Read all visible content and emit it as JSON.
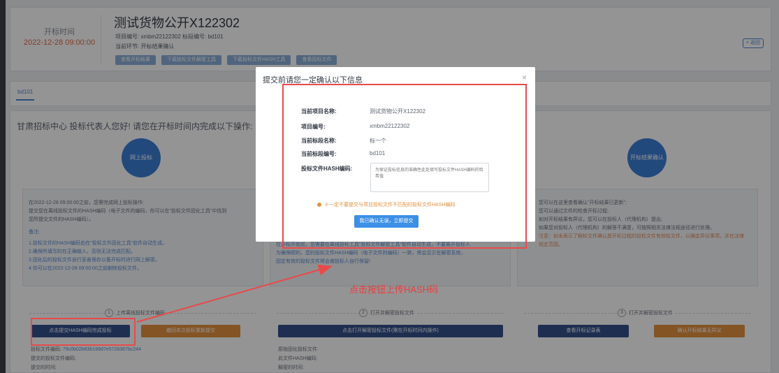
{
  "header": {
    "open_time_label": "开标时间",
    "open_time_value": "2022-12-28 09:00:00",
    "project_title": "测试货物公开X122302",
    "meta_line1": "项目编号: xmbm22122302  标段编号: bd101",
    "meta_line2": "当前环节: 开标结果确认",
    "buttons": [
      "查看开标结果",
      "下载投标文件解密工具",
      "下载投标文件HASH工具",
      "查看招标文件"
    ],
    "back_label": "< 返回"
  },
  "tabs": [
    "bd101"
  ],
  "greeting": "甘肃招标中心 投标代表人您好! 请您在开标时间内完成以下操作:",
  "columns": [
    {
      "circle_label": "网上投标",
      "panel_lines": [
        "在2022-12-28 09:00:00之前，您需完成网上投标操作:",
        "提交您在离线投标文件的HASH编码（电子文件的编码，你可以在\"投标文件固化工具\"中找到",
        "您所提交文件的HASH编码）。",
        "备注:",
        "1.投标文件的HASH编码由在\"投标文件固化工具\"软件自动生成。",
        "2.确保所填写的在正确输入，否则无法完成匹配。",
        "3.固化后的投标文件自行妥善保存以备开标时进行网上解密。",
        "4.你可以在2022-12-28 09:00:00之前删除投标文件。"
      ],
      "step_num": "1",
      "step_label": "上传离线投标文件编码",
      "btn_primary": "点击提交HASH编码完成投标",
      "btn_secondary": "撤回本次投标重新提交",
      "bottom_lines": [
        {
          "label": "投标文件编码:",
          "value": "79c0b02b83b199d7e5726367bc244"
        },
        {
          "label": "提交的投标文件编码:",
          "value": ""
        },
        {
          "label": "提交的时间:",
          "value": ""
        }
      ]
    },
    {
      "panel_lines": [
        "在开标开始前，您需要在离线投标工具\"投标文件解密工具\"软件自动生成，不要离开投标人",
        "为确保顺利，您的投标文件HASH编码（电子文件的编码）一致，将会显示在解密系统，",
        "固定有效的投标文件将会被投标人自行保留!"
      ],
      "step_num": "2",
      "step_label": "打开并解密投标文件",
      "btn_primary": "点击打开解密投标文件(需在开标时间内操作)",
      "bottom_lines": [
        {
          "label": "原始固化投标文件:",
          "value": ""
        },
        {
          "label": "此文件HASH编码:",
          "value": ""
        },
        {
          "label": "解密的时间:",
          "value": ""
        }
      ]
    },
    {
      "circle_label": "开标结果确认",
      "panel_lines": [
        "您可以在这里查看确认\"开标结果已更新\";",
        "您可以通过文件的检查开标过程;",
        "如对开标结果有异议，您可以在投标人（代理机构）提出;",
        "如果您对投标人（代理机构）的解答不满意，可按照相关法律法规途径进行处理。",
        "注意：如未表示了解标文件确认是开标过程的投标文件有效标文件，以确定异议事项，并在法律",
        "规定范围。"
      ],
      "step_num": "3",
      "step_label": "打开并解密投标文件",
      "btn_primary": "查看开标记录表",
      "btn_secondary": "确认开标结果无异议"
    }
  ],
  "dialog": {
    "title": "提交前请您一定确认以下信息",
    "close_glyph": "×",
    "fields": [
      {
        "label": "当前项目名称:",
        "value": "测试货物公开X122302"
      },
      {
        "label": "项目编号:",
        "value": "xmbm22122302"
      },
      {
        "label": "当前标段名称:",
        "value": "标一个"
      },
      {
        "label": "当前标段编号:",
        "value": "bd101"
      },
      {
        "label": "投标文件HASH编码:",
        "value": ""
      }
    ],
    "hash_placeholder": "为保证投标信息的准确性此处填写投标文件HASH编码的哈希值",
    "warning": "※一定不要提交与项目投标文件不匹配的投标文件HASH编码",
    "confirm_label": "我已确认无误，立即提交"
  },
  "annotation": {
    "text": "点击按钮上传HASH码",
    "color": "#f23a3a"
  },
  "colors": {
    "accent": "#3c7ed6",
    "dark_button": "#34508c",
    "orange_button": "#e4913f",
    "annotation_red": "#e84a4a"
  }
}
